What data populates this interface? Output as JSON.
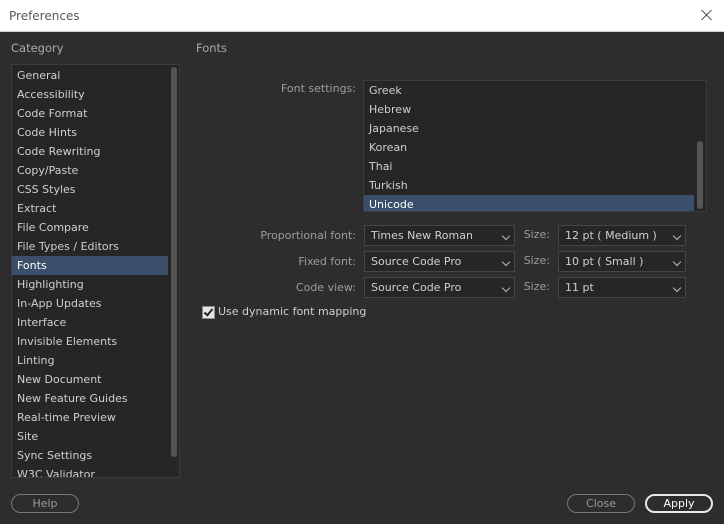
{
  "window": {
    "title": "Preferences"
  },
  "category": {
    "header": "Category",
    "selected": "Fonts",
    "items": [
      "General",
      "Accessibility",
      "Code Format",
      "Code Hints",
      "Code Rewriting",
      "Copy/Paste",
      "CSS Styles",
      "Extract",
      "File Compare",
      "File Types / Editors",
      "Fonts",
      "Highlighting",
      "In-App Updates",
      "Interface",
      "Invisible Elements",
      "Linting",
      "New Document",
      "New Feature Guides",
      "Real-time Preview",
      "Site",
      "Sync Settings",
      "W3C Validator"
    ]
  },
  "panel": {
    "header": "Fonts",
    "font_settings_label": "Font settings:",
    "font_settings_items": [
      "Greek",
      "Hebrew",
      "Japanese",
      "Korean",
      "Thai",
      "Turkish",
      "Unicode"
    ],
    "font_settings_selected": "Unicode",
    "rows": [
      {
        "label": "Proportional font:",
        "font": "Times New Roman",
        "size_label": "Size:",
        "size": "12 pt  ( Medium )"
      },
      {
        "label": "Fixed font:",
        "font": "Source Code Pro",
        "size_label": "Size:",
        "size": "10 pt  ( Small )"
      },
      {
        "label": "Code view:",
        "font": "Source Code Pro",
        "size_label": "Size:",
        "size": "11 pt"
      }
    ],
    "dynamic_mapping": {
      "label": "Use dynamic font mapping",
      "checked": true
    }
  },
  "buttons": {
    "help": "Help",
    "close": "Close",
    "apply": "Apply"
  },
  "colors": {
    "background": "#2d2d2d",
    "selection": "#3b4f6a",
    "list_bg": "#262626"
  }
}
